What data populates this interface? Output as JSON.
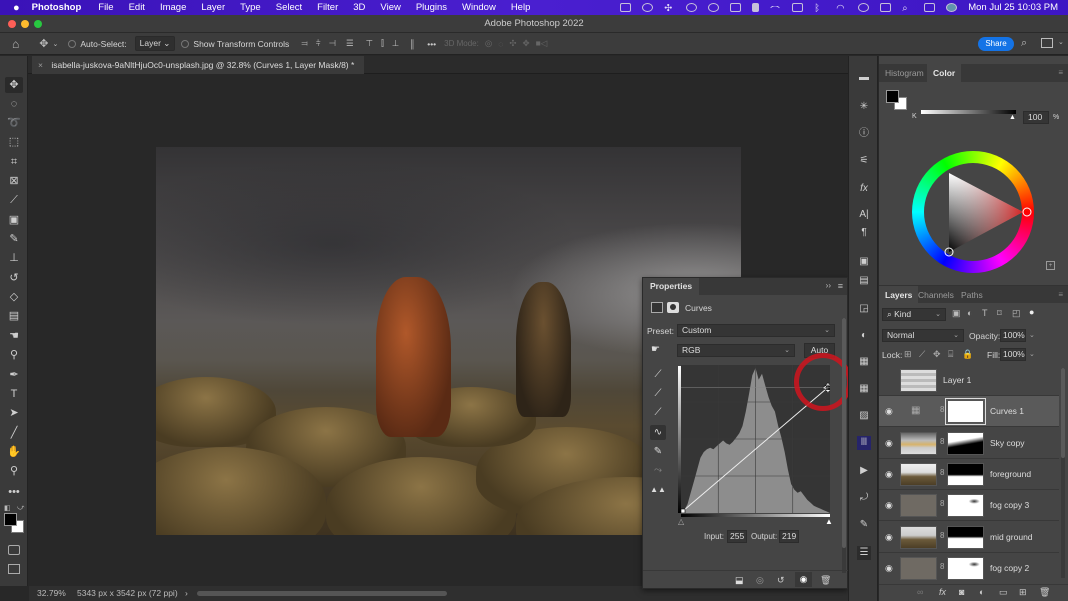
{
  "menubar": {
    "apple": "",
    "app": "Photoshop",
    "items": [
      "File",
      "Edit",
      "Image",
      "Layer",
      "Type",
      "Select",
      "Filter",
      "3D",
      "View",
      "Plugins",
      "Window",
      "Help"
    ],
    "datetime": "Mon Jul 25  10:03 PM"
  },
  "window": {
    "title": "Adobe Photoshop 2022"
  },
  "options": {
    "auto_select_label": "Auto-Select:",
    "auto_select_value": "Layer",
    "transform_label": "Show Transform Controls",
    "three_d_label": "3D Mode:",
    "more": "•••",
    "share": "Share"
  },
  "document": {
    "tab_title": "isabella-juskova-9aNltHjuOc0-unsplash.jpg @ 32.8% (Curves 1, Layer Mask/8) *",
    "close": "×"
  },
  "statusbar": {
    "zoom": "32.79%",
    "info": "5343 px x 3542 px (72 ppi)",
    "arrow": "›"
  },
  "tools": [
    {
      "name": "move-tool",
      "glyph": "✥"
    },
    {
      "name": "marquee-tool",
      "glyph": "◌"
    },
    {
      "name": "lasso-tool",
      "glyph": "➰"
    },
    {
      "name": "object-select-tool",
      "glyph": "⬚"
    },
    {
      "name": "crop-tool",
      "glyph": "⌗"
    },
    {
      "name": "frame-tool",
      "glyph": "⊠"
    },
    {
      "name": "eyedropper-tool",
      "glyph": "⟋"
    },
    {
      "name": "healing-tool",
      "glyph": "▣"
    },
    {
      "name": "brush-tool",
      "glyph": "✎"
    },
    {
      "name": "stamp-tool",
      "glyph": "⊥"
    },
    {
      "name": "history-brush-tool",
      "glyph": "↺"
    },
    {
      "name": "eraser-tool",
      "glyph": "◇"
    },
    {
      "name": "gradient-tool",
      "glyph": "▤"
    },
    {
      "name": "blur-tool",
      "glyph": "☚"
    },
    {
      "name": "dodge-tool",
      "glyph": "⚲"
    },
    {
      "name": "pen-tool",
      "glyph": "✒"
    },
    {
      "name": "type-tool",
      "glyph": "T"
    },
    {
      "name": "path-select-tool",
      "glyph": "➤"
    },
    {
      "name": "line-tool",
      "glyph": "╱"
    },
    {
      "name": "hand-tool",
      "glyph": "✋"
    },
    {
      "name": "zoom-tool",
      "glyph": "⚲"
    },
    {
      "name": "more-tools",
      "glyph": "•••"
    }
  ],
  "properties": {
    "tab": "Properties",
    "type": "Curves",
    "preset_label": "Preset:",
    "preset_value": "Custom",
    "channel_value": "RGB",
    "auto": "Auto",
    "input_label": "Input:",
    "input_value": "255",
    "output_label": "Output:",
    "output_value": "219",
    "collapse": "››",
    "menu": "≡"
  },
  "curve": {
    "points": [
      [
        0,
        0
      ],
      [
        255,
        219
      ]
    ]
  },
  "color_panel": {
    "tabs": [
      "Histogram",
      "Color"
    ],
    "active_tab": "Color",
    "slider_label": "K",
    "value": "100",
    "unit": "%",
    "foreground": "#000000",
    "background": "#ffffff",
    "hue_color": "#ff1a1a"
  },
  "layers_panel": {
    "tabs": [
      "Layers",
      "Channels",
      "Paths"
    ],
    "active_tab": "Layers",
    "filter": "Kind",
    "blend_mode": "Normal",
    "opacity_label": "Opacity:",
    "opacity_value": "100%",
    "lock_label": "Lock:",
    "fill_label": "Fill:",
    "fill_value": "100%",
    "layers": [
      {
        "name": "Layer 1",
        "visible": false,
        "has_mask": false,
        "selected": false
      },
      {
        "name": "Curves 1",
        "visible": true,
        "has_mask": true,
        "selected": true
      },
      {
        "name": "Sky copy",
        "visible": true,
        "has_mask": true,
        "selected": false
      },
      {
        "name": "foreground",
        "visible": true,
        "has_mask": true,
        "selected": false
      },
      {
        "name": "fog copy 3",
        "visible": true,
        "has_mask": true,
        "selected": false
      },
      {
        "name": "mid ground",
        "visible": true,
        "has_mask": true,
        "selected": false
      },
      {
        "name": "fog copy 2",
        "visible": true,
        "has_mask": true,
        "selected": false
      }
    ]
  }
}
